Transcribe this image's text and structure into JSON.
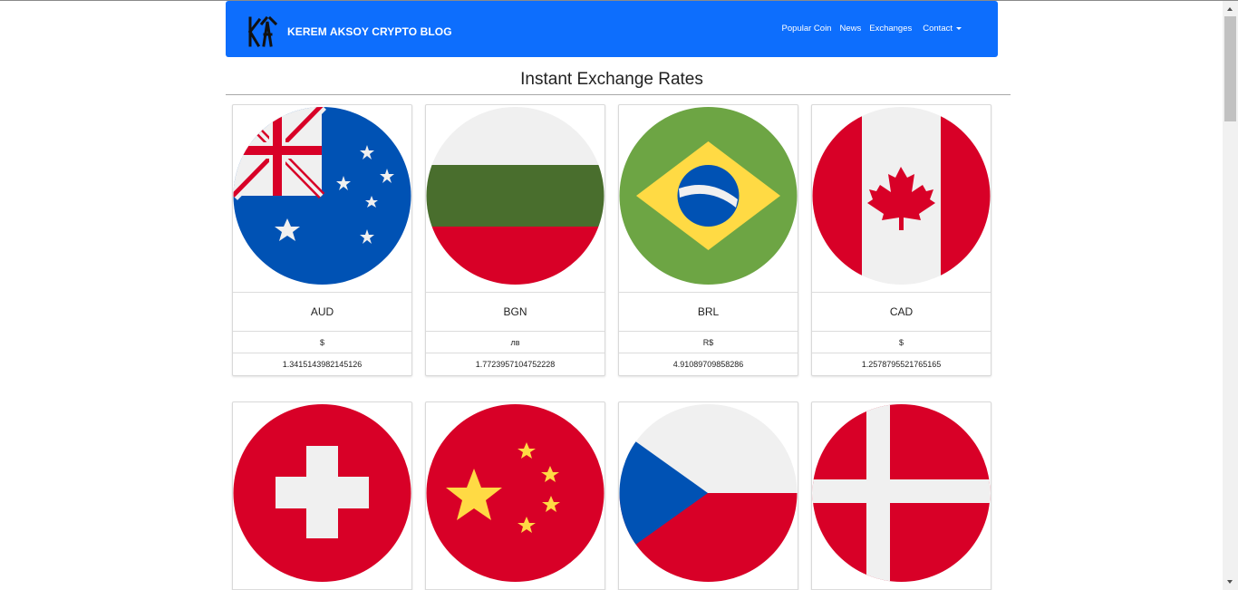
{
  "navbar": {
    "brand": "KEREM AKSOY CRYPTO BLOG",
    "links": [
      "Popular Coin",
      "News",
      "Exchanges",
      "Contact"
    ]
  },
  "page": {
    "title": "Instant Exchange Rates"
  },
  "currencies": [
    {
      "code": "AUD",
      "symbol": "$",
      "rate": "1.3415143982145126",
      "flag": "australia-flag"
    },
    {
      "code": "BGN",
      "symbol": "лв",
      "rate": "1.7723957104752228",
      "flag": "bulgaria-flag"
    },
    {
      "code": "BRL",
      "symbol": "R$",
      "rate": "4.91089709858286",
      "flag": "brazil-flag"
    },
    {
      "code": "CAD",
      "symbol": "$",
      "rate": "1.2578795521765165",
      "flag": "canada-flag"
    },
    {
      "flag": "switzerland-flag"
    },
    {
      "flag": "china-flag"
    },
    {
      "flag": "czech-republic-flag"
    },
    {
      "flag": "denmark-flag"
    }
  ],
  "colors": {
    "navbar": "#0d6efd",
    "flag_red": "#d80027",
    "flag_blue": "#0052b4",
    "flag_green": "#6da544",
    "flag_yellow": "#ffda44",
    "flag_white": "#f0f0f0"
  }
}
